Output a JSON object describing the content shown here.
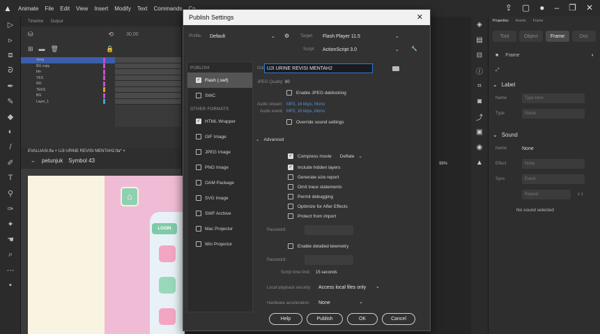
{
  "menubar": {
    "items": [
      "Animate",
      "File",
      "Edit",
      "View",
      "Insert",
      "Modify",
      "Text",
      "Commands",
      "Co"
    ]
  },
  "timeline": {
    "tabs": [
      "Timeline",
      "Output"
    ],
    "fps": "30,00",
    "layers": [
      "dong",
      "BG copy",
      "btn",
      "YES",
      "NO",
      "TEKS",
      "BG",
      "Layer_1"
    ]
  },
  "stage": {
    "tab": "EVALUASI.fla ×   UJI URINE REVISI MENTAH2.fla* ×",
    "crumb_scene": "petunjuk",
    "crumb_symbol": "Symbol 43",
    "login_label": "LOGIN",
    "colors": {
      "stage_bg": "#f9f3e1",
      "pink": "#f0bcd5",
      "mint": "#8fd0b0"
    }
  },
  "props": {
    "tabs": [
      "Properties",
      "Assets",
      "Frame"
    ],
    "subtabs": [
      "Tool",
      "Object",
      "Frame",
      "Doc"
    ],
    "frame_label": "Frame",
    "label_section": "Label",
    "name_label": "Name",
    "name_placeholder": "Type here",
    "type_label": "Type",
    "type_value": "Name",
    "sound_section": "Sound",
    "sound_name_label": "Name",
    "sound_name_value": "None",
    "effect_label": "Effect",
    "effect_value": "None",
    "sync_label": "Sync",
    "sync_value": "Event",
    "repeat_value": "Repeat",
    "repeat_count": "x 1",
    "no_sound": "No sound selected"
  },
  "dialog": {
    "title": "Publish Settings",
    "profile_label": "Profile:",
    "profile_value": "Default",
    "target_label": "Target:",
    "target_value": "Flash Player 11.5",
    "script_label": "Script:",
    "script_value": "ActionScript 3.0",
    "publish_group": "PUBLISH",
    "other_group": "OTHER FORMATS",
    "formats_publish": [
      {
        "label": "Flash (.swf)",
        "checked": true,
        "active": true
      },
      {
        "label": "SWC",
        "checked": false,
        "active": false
      }
    ],
    "formats_other": [
      {
        "label": "HTML Wrapper",
        "checked": true
      },
      {
        "label": "GIF Image",
        "checked": false
      },
      {
        "label": "JPEG Image",
        "checked": false
      },
      {
        "label": "PNG Image",
        "checked": false
      },
      {
        "label": "OAM Package",
        "checked": false
      },
      {
        "label": "SVG Image",
        "checked": false
      },
      {
        "label": "SWF Archive",
        "checked": false
      },
      {
        "label": "Mac Projector",
        "checked": false
      },
      {
        "label": "Win Projector",
        "checked": false
      }
    ],
    "output_label": "Output name:",
    "output_value": "UJI URINE REVISI MENTAH2",
    "jpeg_label": "JPEG Quality:",
    "jpeg_value": "80",
    "deblock": "Enable JPEG deblocking",
    "audio_stream_label": "Audio stream:",
    "audio_stream_value": "MP3, 16 kbps, Mono",
    "audio_event_label": "Audio event:",
    "audio_event_value": "MP3, 16 kbps, Mono",
    "override_sound": "Override sound settings",
    "advanced": "Advanced",
    "compress": "Compress movie",
    "compress_value": "Deflate",
    "include_hidden": "Include hidden layers",
    "size_report": "Generate size report",
    "omit_trace": "Omit trace statements",
    "permit_debug": "Permit debugging",
    "optimize_ae": "Optimize for After Effects",
    "protect_import": "Protect from import",
    "password_label": "Password:",
    "telemetry": "Enable detailed telemetry",
    "password2_label": "Password:",
    "script_limit_label": "Script time limit:",
    "script_limit_value": "15 seconds",
    "local_security_label": "Local playback security:",
    "local_security_value": "Access local files only",
    "hw_accel_label": "Hardware acceleration:",
    "hw_accel_value": "None",
    "btn_help": "Help",
    "btn_publish": "Publish",
    "btn_ok": "OK",
    "btn_cancel": "Cancel"
  },
  "zoom": "98%"
}
